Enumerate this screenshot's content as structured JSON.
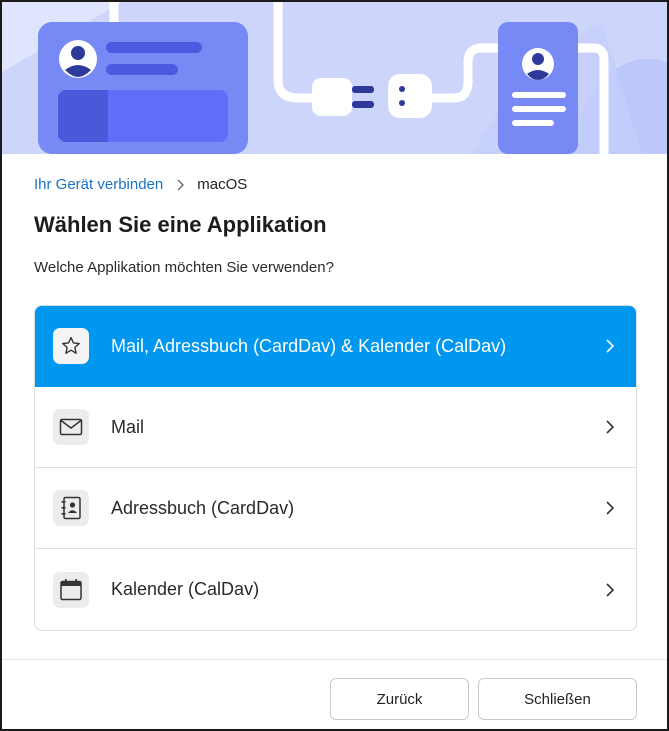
{
  "breadcrumb": {
    "parent": "Ihr Gerät verbinden",
    "current": "macOS"
  },
  "title": "Wählen Sie eine Applikation",
  "subtitle": "Welche Applikation möchten Sie verwenden?",
  "options": [
    {
      "label": "Mail, Adressbuch (CardDav) & Kalender (CalDav)",
      "icon": "star-icon",
      "selected": true
    },
    {
      "label": "Mail",
      "icon": "envelope-icon",
      "selected": false
    },
    {
      "label": "Adressbuch (CardDav)",
      "icon": "contacts-book-icon",
      "selected": false
    },
    {
      "label": "Kalender (CalDav)",
      "icon": "calendar-icon",
      "selected": false
    }
  ],
  "buttons": {
    "back": "Zurück",
    "close": "Schließen"
  },
  "colors": {
    "accent": "#0097f0",
    "link": "#1a73c4",
    "banner_bg": "#cdd5fb",
    "illustration": "#6b7ff5"
  }
}
